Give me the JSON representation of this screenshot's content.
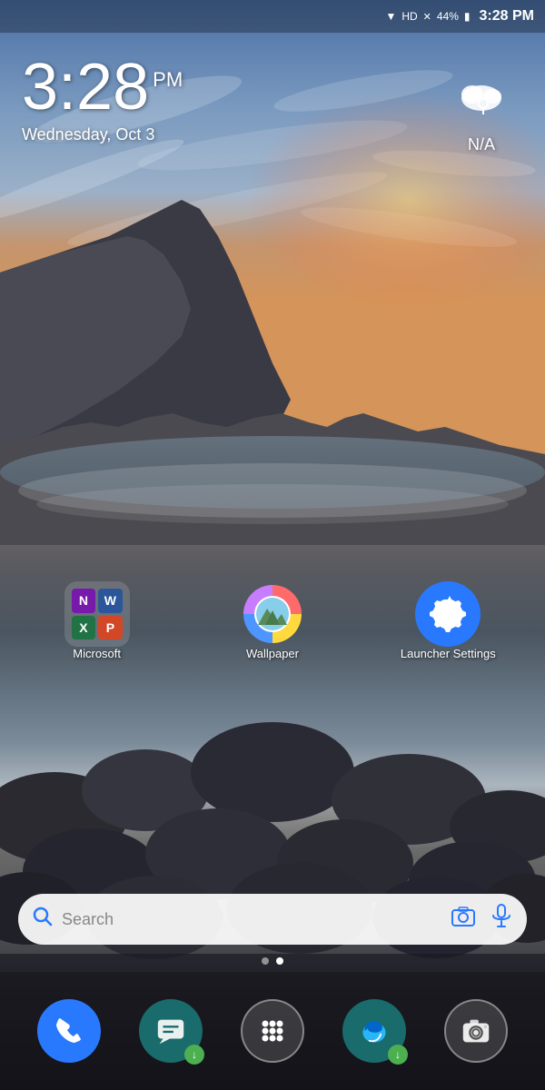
{
  "statusBar": {
    "time": "3:28 PM",
    "battery": "44%",
    "signal": "HD"
  },
  "clock": {
    "time": "3:28",
    "ampm": "PM",
    "date": "Wednesday, Oct 3"
  },
  "weather": {
    "icon": "☁",
    "temp": "N/A"
  },
  "apps": [
    {
      "id": "microsoft",
      "label": "Microsoft",
      "type": "folder"
    },
    {
      "id": "wallpaper",
      "label": "Wallpaper",
      "type": "wallpaper"
    },
    {
      "id": "launcher-settings",
      "label": "Launcher Settings",
      "type": "settings"
    }
  ],
  "searchBar": {
    "placeholder": "Search"
  },
  "dock": [
    {
      "id": "phone",
      "label": "Phone"
    },
    {
      "id": "messages",
      "label": "Messages"
    },
    {
      "id": "app-drawer",
      "label": "App Drawer"
    },
    {
      "id": "edge",
      "label": "Microsoft Edge"
    },
    {
      "id": "camera",
      "label": "Camera"
    }
  ],
  "pageDots": {
    "total": 2,
    "active": 1
  }
}
